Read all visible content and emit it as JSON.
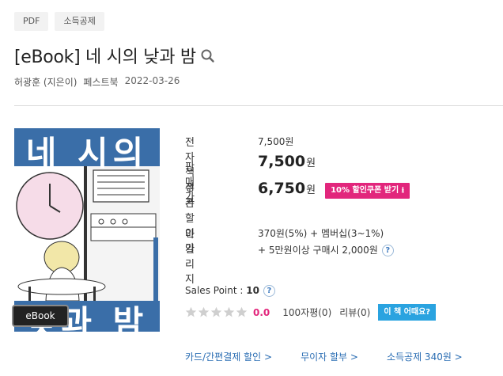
{
  "tags": [
    "PDF",
    "소득공제"
  ],
  "title": "[eBook] 네 시의 낮과 밤",
  "meta": {
    "author": "허광훈 (지은이)",
    "publisher": "페스트북",
    "date": "2022-03-26"
  },
  "cover": {
    "title_top": "네 시의",
    "title_bottom": "낮과 밤",
    "badge": "eBook"
  },
  "prices": {
    "list_label": "전자책정가",
    "list_value": "7,500원",
    "sale_label": "판매가",
    "sale_value": "7,500",
    "sale_unit": "원",
    "coupon_label": "쿠폰할인가",
    "coupon_value": "6,750",
    "coupon_unit": "원",
    "coupon_button": "10% 할인쿠폰 받기 ⭳"
  },
  "mileage": {
    "label": "마일리지",
    "line1": "370원(5%) + 멤버십(3~1%)",
    "line2": "+ 5만원이상 구매시 2,000원"
  },
  "sales_point": {
    "label": "Sales Point : ",
    "value": "10"
  },
  "rating": {
    "stars": 0,
    "score": "0.0",
    "review100": "100자평(0)",
    "review": "리뷰(0)",
    "how_button": "이 책 어때요?"
  },
  "links": [
    "카드/간편결제 할인 >",
    "무이자 할부 >",
    "소득공제 340원 >"
  ],
  "colors": {
    "accent_pink": "#e2267c",
    "accent_blue": "#2aa3e0",
    "link_blue": "#2a6db3",
    "cover_blue": "#3a6ea8"
  },
  "icons": {
    "search": "search-icon",
    "help": "question-icon",
    "star": "star-icon"
  }
}
